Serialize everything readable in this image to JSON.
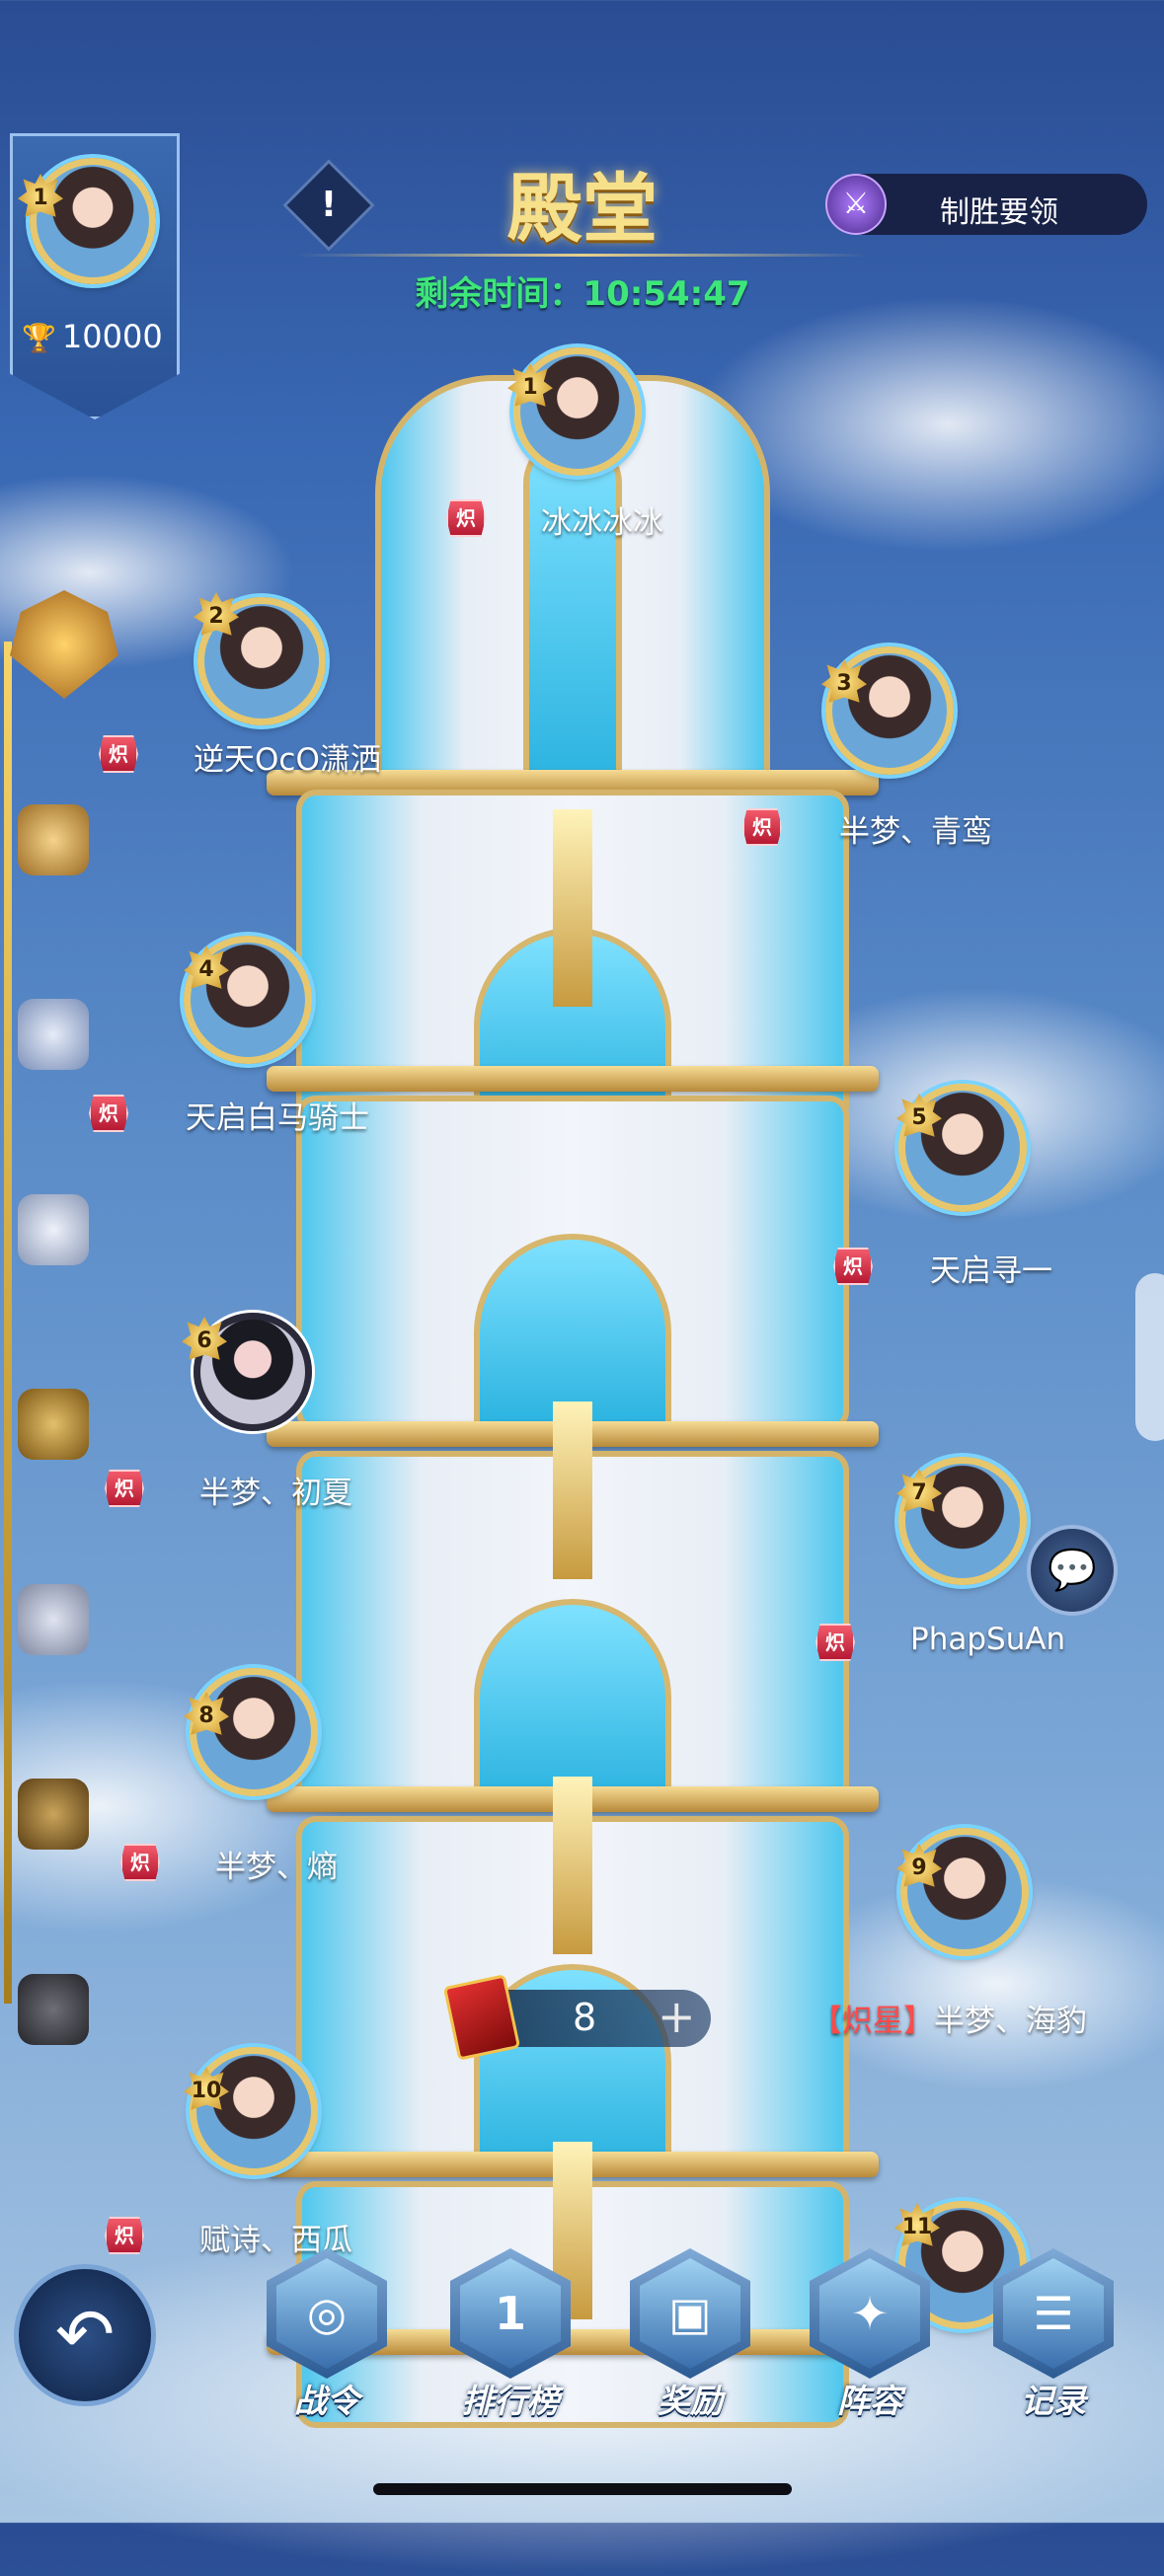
{
  "header": {
    "title": "殿堂",
    "timer": "剩余时间：10:54:47",
    "info_icon": "exclamation-icon",
    "tips_button_label": "制胜要领",
    "tips_icon": "sword-icon"
  },
  "my_rank": {
    "rank": "1",
    "score": "10000",
    "score_icon": "trophy-icon"
  },
  "players": [
    {
      "rank": "1",
      "tag": "炽星",
      "name": "冰冰冰冰"
    },
    {
      "rank": "2",
      "tag": "炽星",
      "name": "逆天OcO潇洒"
    },
    {
      "rank": "3",
      "tag": "炽星",
      "name": "半梦、青鸾"
    },
    {
      "rank": "4",
      "tag": "炽星",
      "name": "天启白马骑士"
    },
    {
      "rank": "5",
      "tag": "炽星",
      "name": "天启寻一"
    },
    {
      "rank": "6",
      "tag": "炽星",
      "name": "半梦、初夏"
    },
    {
      "rank": "7",
      "tag": "炽星",
      "name": "PhapSuAn"
    },
    {
      "rank": "8",
      "tag": "炽星",
      "name": "半梦、熵"
    },
    {
      "rank": "9",
      "tag_bracket": "【炽星】",
      "name": "半梦、海豹"
    },
    {
      "rank": "10",
      "tag": "炽星",
      "name": "赋诗、西瓜"
    },
    {
      "rank": "11"
    }
  ],
  "counter": {
    "value": "8",
    "plus": "+"
  },
  "nav": [
    {
      "label": "战令",
      "icon": "compass-icon"
    },
    {
      "label": "排行榜",
      "icon": "podium-icon",
      "glyph": "1"
    },
    {
      "label": "奖励",
      "icon": "gift-icon"
    },
    {
      "label": "阵容",
      "icon": "shield-star-icon"
    },
    {
      "label": "记录",
      "icon": "document-icon"
    }
  ],
  "colors": {
    "timer": "#3ee67a",
    "title": "#f7e08a",
    "tag": "#d0263f",
    "gold": "#d4b46a"
  }
}
